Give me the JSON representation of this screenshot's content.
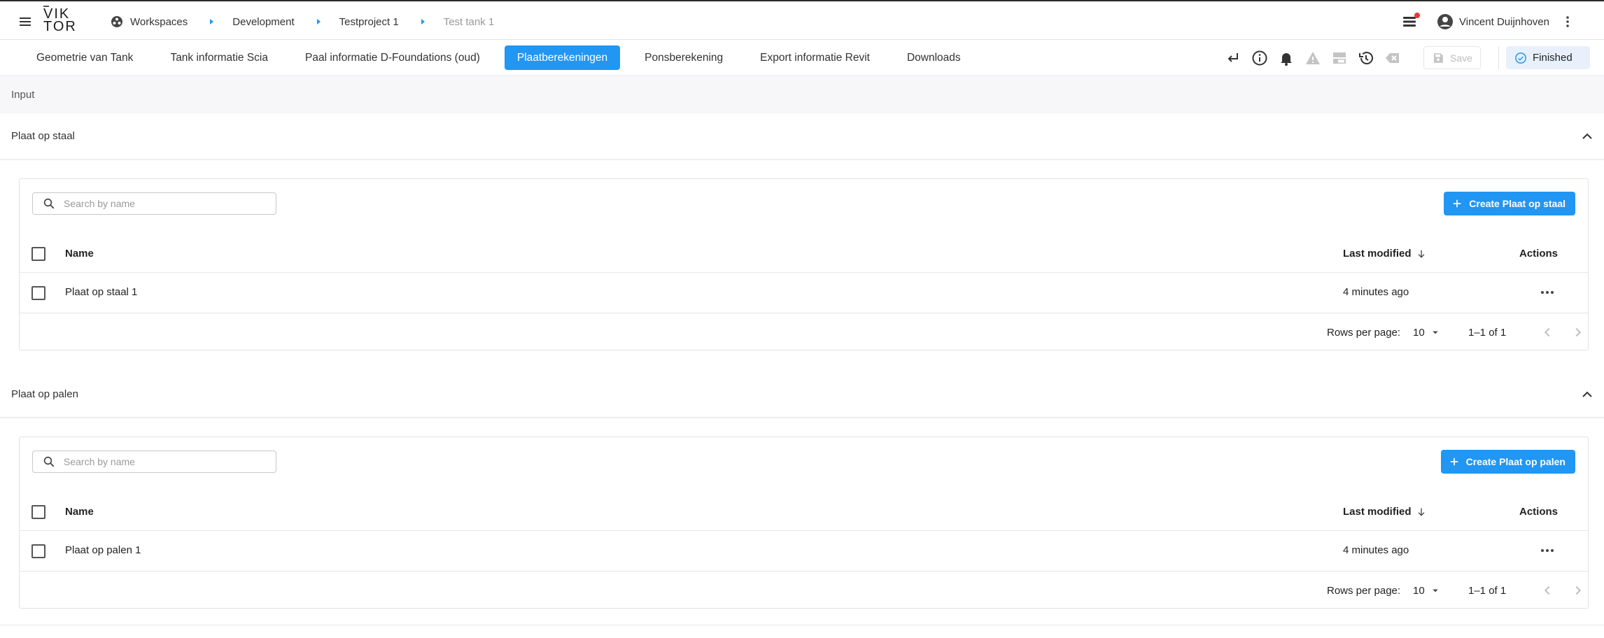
{
  "header": {
    "logo_line1": "VIK",
    "logo_line2": "TOR",
    "breadcrumb": [
      "Workspaces",
      "Development",
      "Testproject 1",
      "Test tank 1"
    ],
    "user_name": "Vincent Duijnhoven"
  },
  "tabs": [
    {
      "label": "Geometrie van Tank",
      "active": false
    },
    {
      "label": "Tank informatie Scia",
      "active": false
    },
    {
      "label": "Paal informatie D-Foundations (oud)",
      "active": false
    },
    {
      "label": "Plaatberekeningen",
      "active": true
    },
    {
      "label": "Ponsberekening",
      "active": false
    },
    {
      "label": "Export informatie Revit",
      "active": false
    },
    {
      "label": "Downloads",
      "active": false
    }
  ],
  "toolbar": {
    "icons": [
      "return-icon",
      "info-icon",
      "bell-icon",
      "warning-icon",
      "split-view-icon",
      "history-icon",
      "clear-icon"
    ],
    "save_label": "Save",
    "status_label": "Finished"
  },
  "input_label": "Input",
  "sections": [
    {
      "title": "Plaat op staal",
      "search_placeholder": "Search by name",
      "create_label": "Create Plaat op staal",
      "columns": {
        "name": "Name",
        "modified": "Last modified",
        "actions": "Actions"
      },
      "rows": [
        {
          "name": "Plaat op staal 1",
          "modified": "4 minutes ago"
        }
      ],
      "pager": {
        "rows_per_page_label": "Rows per page:",
        "rows_per_page": "10",
        "range": "1–1 of 1"
      }
    },
    {
      "title": "Plaat op palen",
      "search_placeholder": "Search by name",
      "create_label": "Create Plaat op palen",
      "columns": {
        "name": "Name",
        "modified": "Last modified",
        "actions": "Actions"
      },
      "rows": [
        {
          "name": "Plaat op palen 1",
          "modified": "4 minutes ago"
        }
      ],
      "pager": {
        "rows_per_page_label": "Rows per page:",
        "rows_per_page": "10",
        "range": "1–1 of 1"
      }
    }
  ],
  "colors": {
    "accent": "#2196f3",
    "finished_bg": "#e8f1fb",
    "notification_dot": "#e53935",
    "disabled": "#bdbdbd"
  }
}
